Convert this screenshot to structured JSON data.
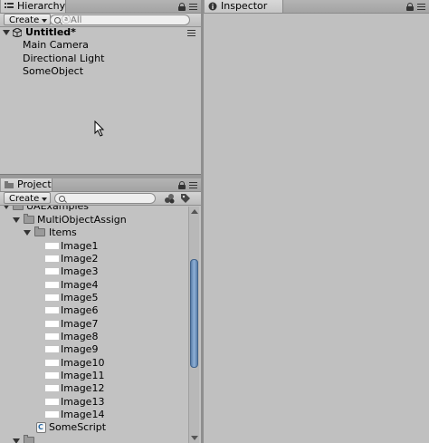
{
  "hierarchy": {
    "tab_label": "Hierarchy",
    "create_label": "Create",
    "search_placeholder": "ⓐAll",
    "scene_name": "Untitled*",
    "items": [
      {
        "label": "Main Camera"
      },
      {
        "label": "Directional Light"
      },
      {
        "label": "SomeObject"
      }
    ]
  },
  "inspector": {
    "tab_label": "Inspector"
  },
  "project": {
    "tab_label": "Project",
    "create_label": "Create",
    "search_placeholder": "",
    "tree": {
      "root": "UAExamples",
      "sub": "MultiObjectAssign",
      "folder": "Items",
      "images": [
        "Image1",
        "Image2",
        "Image3",
        "Image4",
        "Image5",
        "Image6",
        "Image7",
        "Image8",
        "Image9",
        "Image10",
        "Image11",
        "Image12",
        "Image13",
        "Image14"
      ],
      "script": "SomeScript"
    },
    "scroll_position": 0.4
  },
  "colors": {
    "panel_bg": "#c2c2c2",
    "scroll_thumb": "#6a8fbb"
  }
}
